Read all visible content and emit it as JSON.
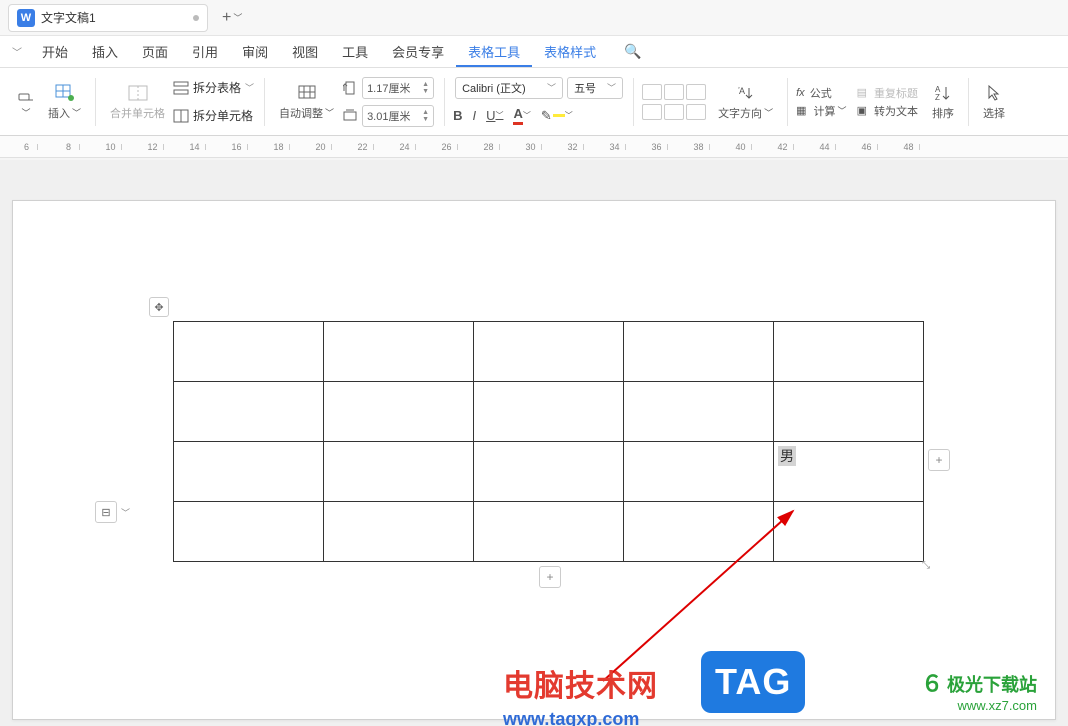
{
  "titlebar": {
    "w_badge": "W",
    "doc_title": "文字文稿1",
    "new_tab_plus": "+",
    "new_tab_chev": "﹀"
  },
  "menu": {
    "chev": "﹀",
    "items": [
      "开始",
      "插入",
      "页面",
      "引用",
      "审阅",
      "视图",
      "工具",
      "会员专享",
      "表格工具",
      "表格样式"
    ],
    "active_index": 8,
    "blue_indices": [
      8,
      9
    ],
    "search_glyph": "🔍"
  },
  "ribbon": {
    "delete_icon": "eraser-icon",
    "insert_label": "插入",
    "merge_cells_label": "合并单元格",
    "split_table_label": "拆分表格",
    "split_cells_label": "拆分单元格",
    "auto_adjust_label": "自动调整",
    "row_height": "1.17厘米",
    "col_width": "3.01厘米",
    "font_name": "Calibri (正文)",
    "font_size": "五号",
    "bold": "B",
    "italic": "I",
    "underline": "U",
    "text_dir_label": "文字方向",
    "formula_label": "fx 公式",
    "repeat_title_label": "重复标题",
    "calc_label": "计算",
    "to_text_label": "转为文本",
    "sort_label": "排序",
    "select_label": "选择",
    "chev": "﹀"
  },
  "ruler": {
    "start": 6,
    "end": 48
  },
  "table": {
    "rows": 4,
    "cols": 5,
    "cell_text": "男",
    "text_row": 2,
    "text_col": 4,
    "move_glyph": "✥",
    "plus": "+",
    "side_glyph": "⊟",
    "side_chev": "﹀",
    "resize_glyph": "⤡"
  },
  "watermark1": {
    "line1": "电脑技术网",
    "line2": "www.tagxp.com",
    "tag": "TAG"
  },
  "watermark2": {
    "line1": "极光下载站",
    "line2": "www.xz7.com",
    "swirl": "６"
  }
}
